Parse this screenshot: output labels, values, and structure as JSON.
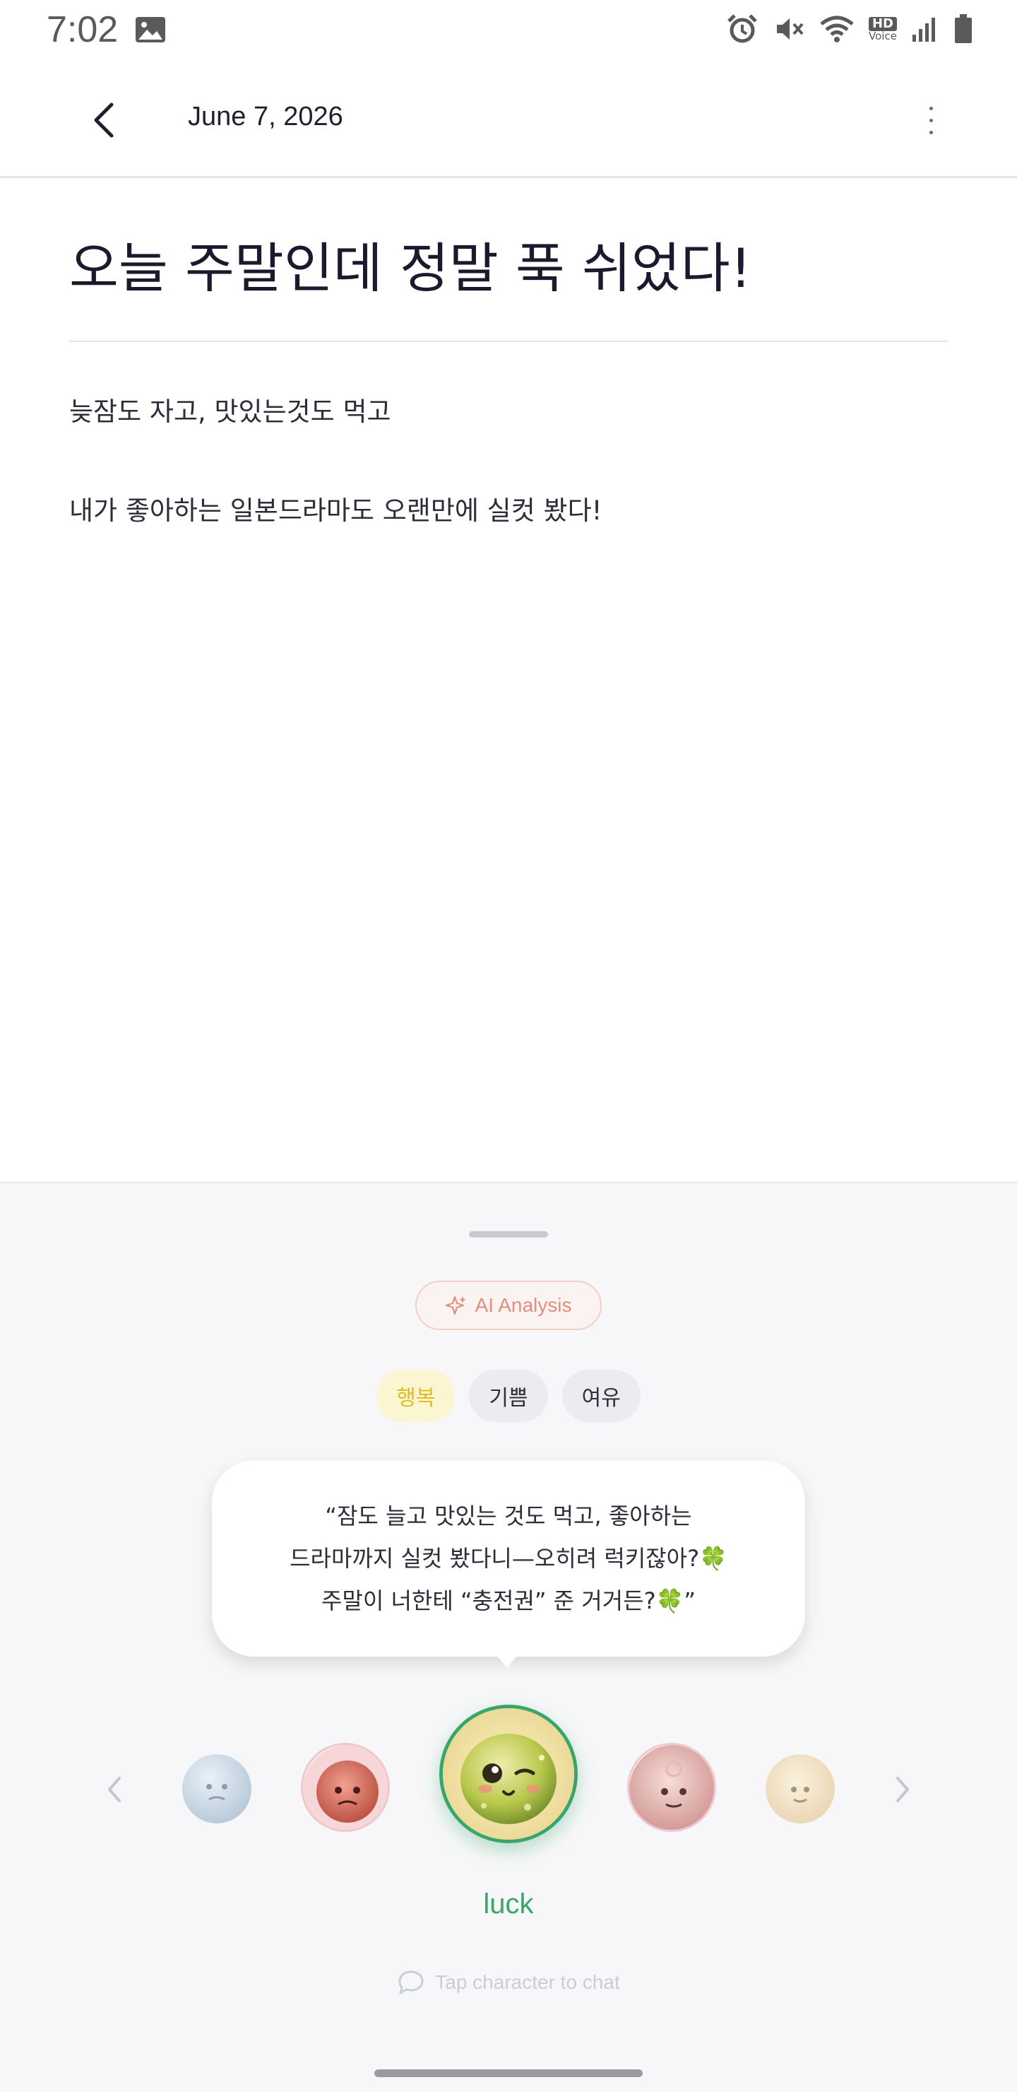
{
  "status_bar": {
    "time": "7:02",
    "icons": [
      "gallery-icon",
      "alarm-icon",
      "mute-icon",
      "wifi-icon",
      "hd-voice-icon",
      "signal-icon",
      "battery-icon"
    ],
    "hd_label": "HD",
    "voice_label": "Voice"
  },
  "app_bar": {
    "date": "June 7, 2026"
  },
  "entry": {
    "title": "오늘 주말인데 정말 푹 쉬었다!",
    "body": [
      "늦잠도 자고, 맛있는것도 먹고",
      "내가 좋아하는 일본드라마도 오랜만에 실컷 봤다!"
    ]
  },
  "analysis": {
    "button_label": "AI Analysis",
    "emotion_tags": [
      "행복",
      "기쁨",
      "여유"
    ],
    "active_tag_index": 0,
    "message_lines": [
      "“잠도 늘고 맛있는 것도 먹고, 좋아하는",
      "드라마까지 실컷 봤다니—오히려 럭키잖아?🍀",
      "주말이 너한테 “충전권” 준 거거든?🍀”"
    ],
    "character_name": "luck",
    "chat_hint": "Tap character to chat"
  },
  "colors": {
    "accent_green": "#3aa56b",
    "tag_active_text": "#e1bc1e",
    "ai_pill_text": "#df8f7d"
  }
}
